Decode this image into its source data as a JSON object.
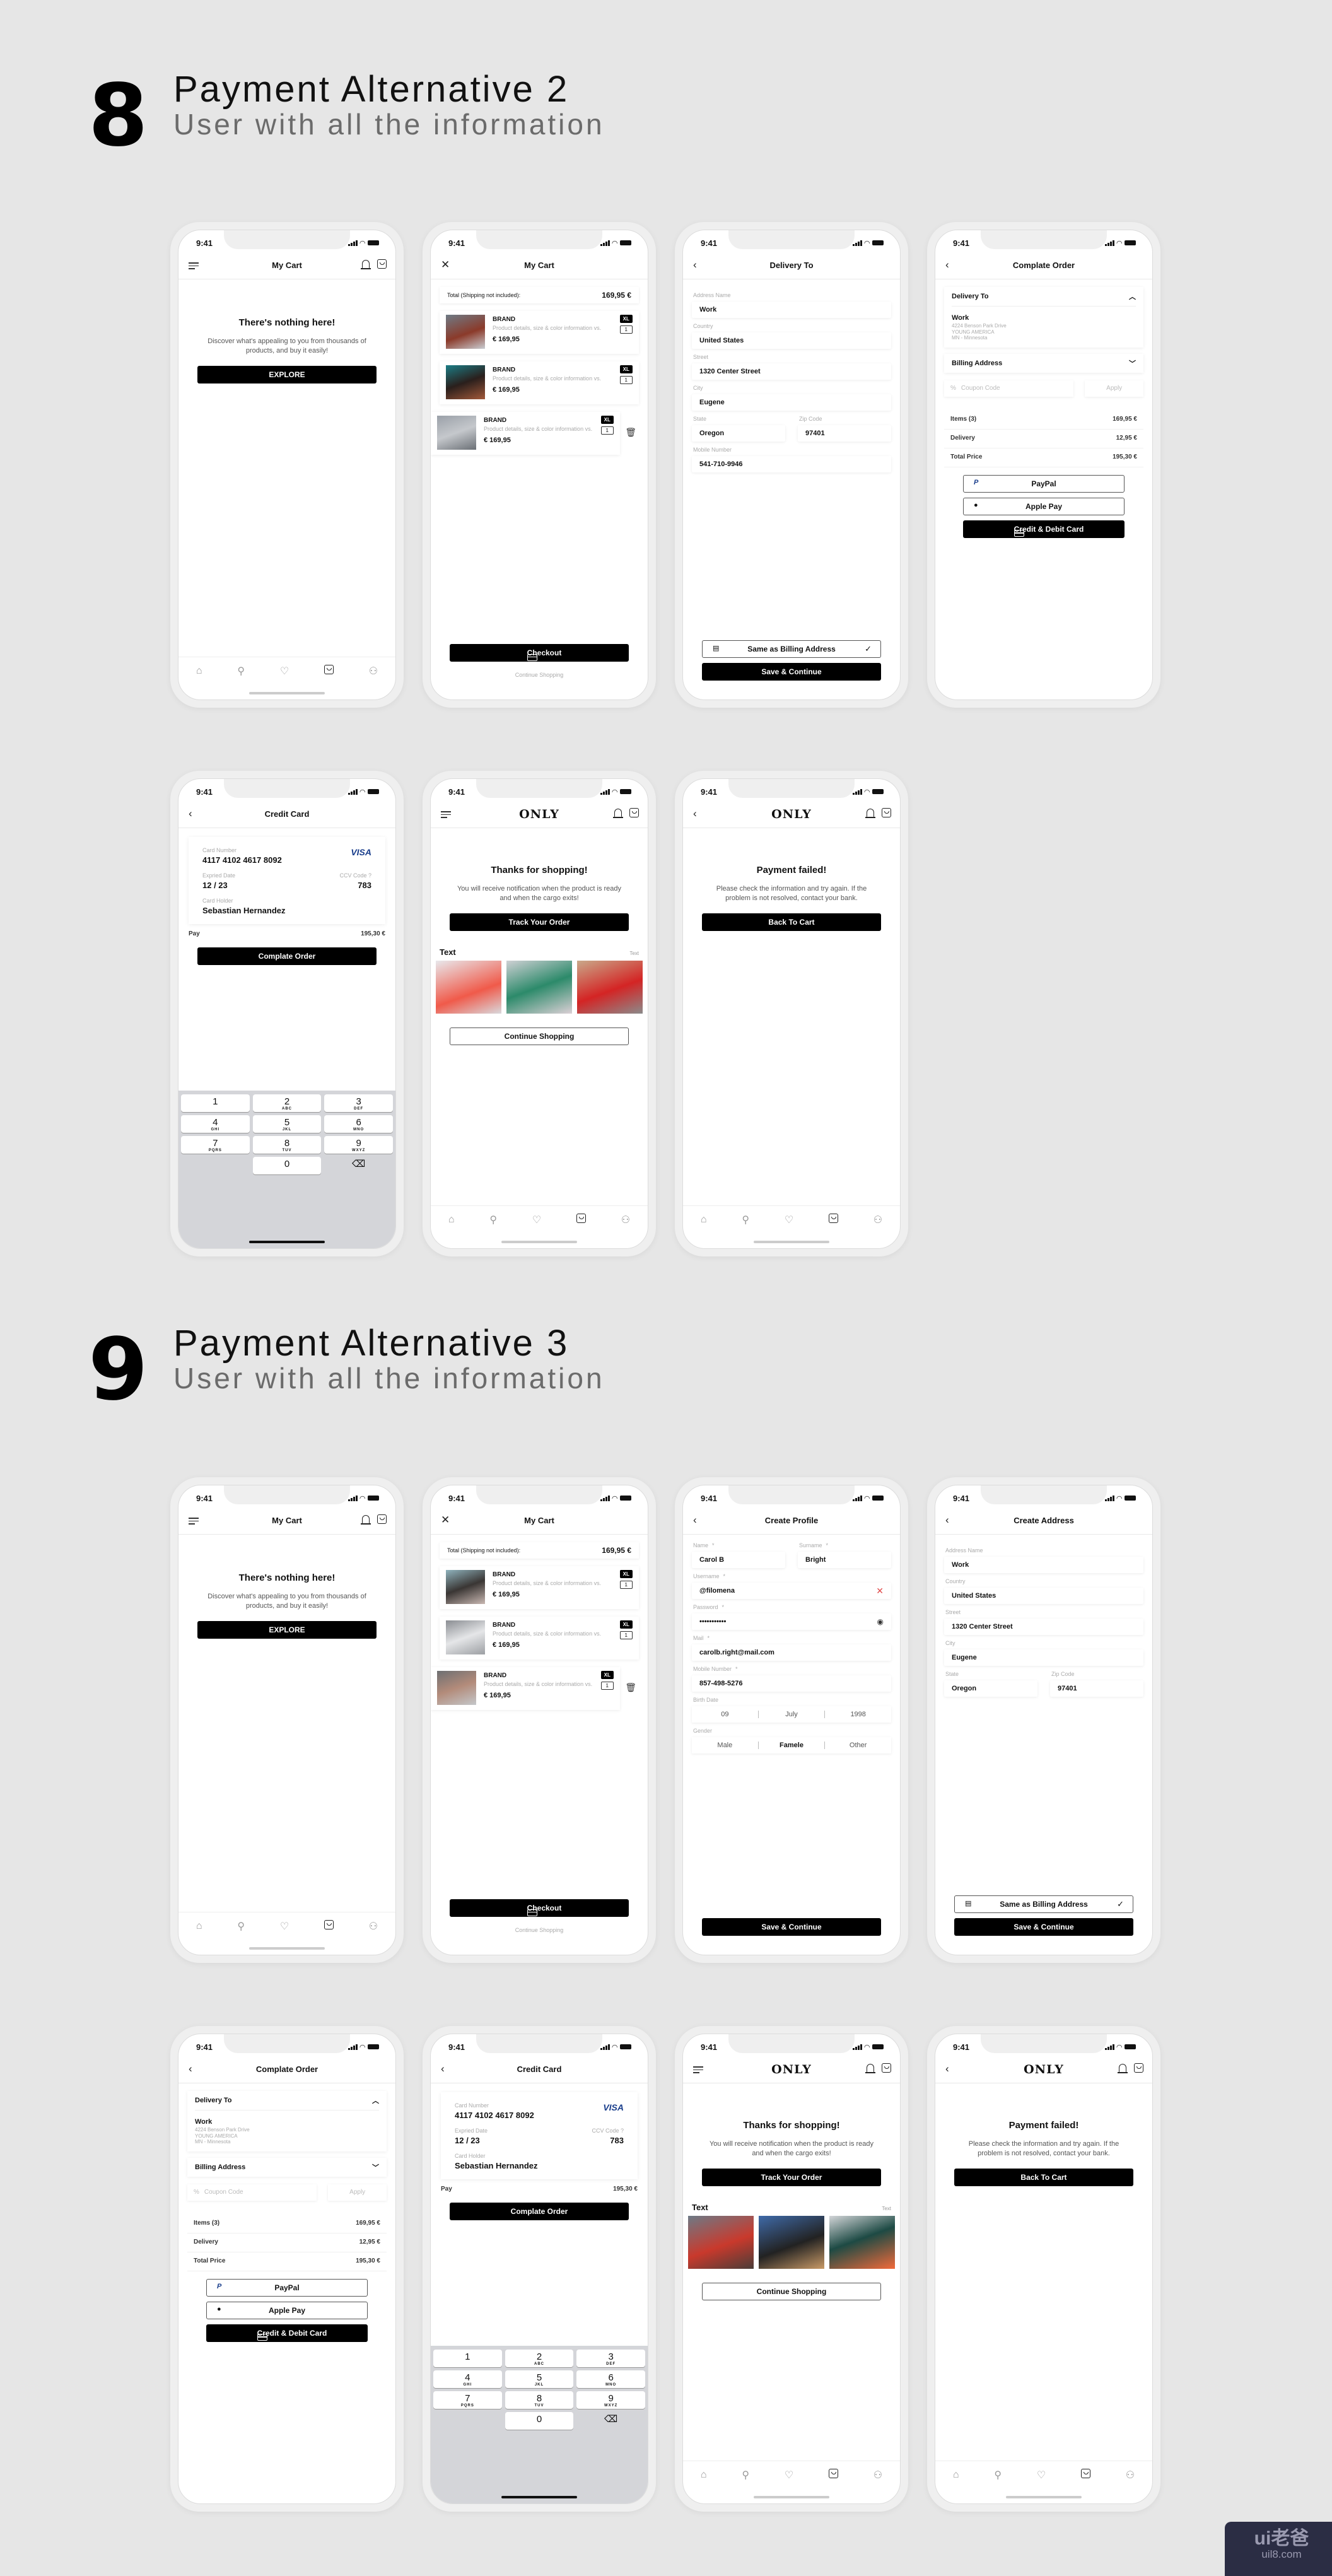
{
  "sections": [
    {
      "number": "8",
      "title": "Payment Alternative 2",
      "subtitle": "User with all the information"
    },
    {
      "number": "9",
      "title": "Payment Alternative 3",
      "subtitle": "User with all the information"
    }
  ],
  "status": {
    "time": "9:41"
  },
  "brand_logo": "ONLY",
  "empty_cart": {
    "title": "My Cart",
    "heading": "There's nothing here!",
    "text": "Discover what's appealing to you from thousands of products, and buy it easily!",
    "button": "EXPLORE"
  },
  "cart": {
    "title": "My Cart",
    "total_label": "Total (Shipping not included):",
    "total_value": "169,95 €",
    "items": [
      {
        "brand": "BRAND",
        "desc": "Product details, size & color information vs.",
        "price": "€ 169,95",
        "size": "XL",
        "qty": "1"
      },
      {
        "brand": "BRAND",
        "desc": "Product details, size & color information vs.",
        "price": "€ 169,95",
        "size": "XL",
        "qty": "1"
      },
      {
        "brand": "BRAND",
        "desc": "Product details, size & color information vs.",
        "price": "€ 169,95",
        "size": "XL",
        "qty": "1"
      }
    ],
    "checkout": "Checkout",
    "continue": "Continue Shopping"
  },
  "address_form": {
    "title_delivery": "Delivery To",
    "title_create": "Create Address",
    "address_name_label": "Address Name",
    "address_name": "Work",
    "country_label": "Country",
    "country": "United States",
    "street_label": "Street",
    "street": "1320 Center Street",
    "city_label": "City",
    "city": "Eugene",
    "state_label": "State",
    "state": "Oregon",
    "zip_label": "Zip Code",
    "zip": "97401",
    "mobile_label": "Mobile Number",
    "mobile": "541-710-9946",
    "same_billing": "Same as Billing Address",
    "save": "Save & Continue"
  },
  "complete_order": {
    "title": "Complate Order",
    "delivery_to": "Delivery To",
    "addr_name": "Work",
    "addr_lines": [
      "4224  Benson Park Drive",
      "YOUNG AMERICA",
      "MN - Minnesota"
    ],
    "billing": "Billing Address",
    "coupon_placeholder": "Coupon Code",
    "apply": "Apply",
    "summary": [
      {
        "label": "Items (3)",
        "value": "169,95 €"
      },
      {
        "label": "Delivery",
        "value": "12,95 €"
      },
      {
        "label": "Total Price",
        "value": "195,30 €"
      }
    ],
    "paypal": "PayPal",
    "applepay": "Apple Pay",
    "card": "Credit & Debit Card"
  },
  "credit_card": {
    "title": "Credit Card",
    "number_label": "Card Number",
    "number": "4117 4102 4617 8092",
    "brand": "VISA",
    "exp_label": "Expried Date",
    "exp": "12 / 23",
    "ccv_label": "CCV Code ?",
    "ccv": "783",
    "holder_label": "Card Holder",
    "holder": "Sebastian Hernandez",
    "pay_label": "Pay",
    "pay_value": "195,30 €",
    "button": "Complate Order",
    "keys": [
      {
        "n": "1",
        "l": ""
      },
      {
        "n": "2",
        "l": "ABC"
      },
      {
        "n": "3",
        "l": "DEF"
      },
      {
        "n": "4",
        "l": "GHI"
      },
      {
        "n": "5",
        "l": "JKL"
      },
      {
        "n": "6",
        "l": "MNO"
      },
      {
        "n": "7",
        "l": "PQRS"
      },
      {
        "n": "8",
        "l": "TUV"
      },
      {
        "n": "9",
        "l": "WXYZ"
      },
      {
        "n": "",
        "l": ""
      },
      {
        "n": "0",
        "l": ""
      },
      {
        "n": "⌫",
        "l": ""
      }
    ]
  },
  "success": {
    "heading": "Thanks for shopping!",
    "text": "You will receive notification when the product is ready and when the cargo exits!",
    "track": "Track Your Order",
    "section_title": "Text",
    "section_link": "Text",
    "continue": "Continue Shopping"
  },
  "failed": {
    "heading": "Payment failed!",
    "text": "Please check the information and try again. If the problem is not resolved, contact your bank.",
    "button": "Back To Cart"
  },
  "profile": {
    "title": "Create Profile",
    "name_label": "Name",
    "name": "Carol B",
    "surname_label": "Surname",
    "surname": "Bright",
    "username_label": "Username",
    "username": "@filomena",
    "password_label": "Password",
    "password": "•••••••••••",
    "mail_label": "Mail",
    "mail": "carolb.right@mail.com",
    "mobile_label": "Mobile Number",
    "mobile": "857-498-5276",
    "birth_label": "Birth Date",
    "birth": [
      "09",
      "July",
      "1998"
    ],
    "gender_label": "Gender",
    "genders": [
      "Male",
      "Famele",
      "Other"
    ],
    "gender_selected": "Famele",
    "required_mark": "*",
    "save": "Save & Continue"
  },
  "watermark": {
    "logo": "ui老爸",
    "url": "uil8.com"
  },
  "colors": {
    "background": "#e6e6e6",
    "primary": "#000000",
    "visa": "#1a3e8c",
    "error": "#e04848"
  }
}
